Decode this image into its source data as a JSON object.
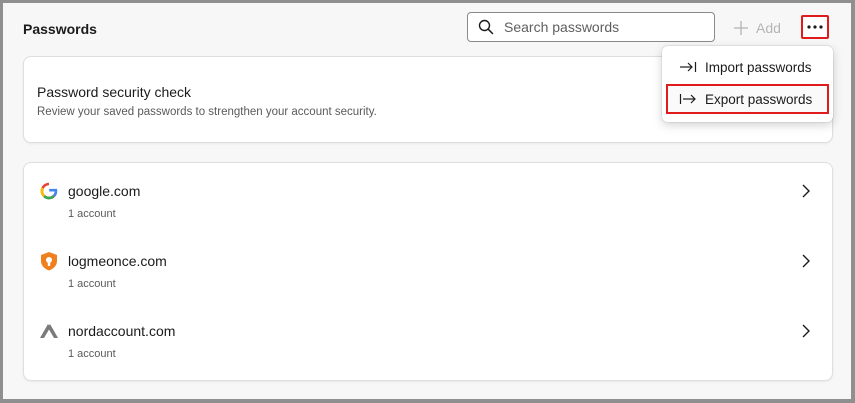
{
  "header": {
    "title": "Passwords",
    "search_placeholder": "Search passwords",
    "add_label": "Add"
  },
  "security_check": {
    "title": "Password security check",
    "subtitle": "Review your saved passwords to strengthen your account security."
  },
  "sites": [
    {
      "domain": "google.com",
      "count": "1 account",
      "icon": "google-icon"
    },
    {
      "domain": "logmeonce.com",
      "count": "1 account",
      "icon": "logmeonce-shield-icon"
    },
    {
      "domain": "nordaccount.com",
      "count": "1 account",
      "icon": "nordaccount-icon"
    }
  ],
  "menu": {
    "items": [
      {
        "label": "Import passwords",
        "icon": "import-icon"
      },
      {
        "label": "Export passwords",
        "icon": "export-icon"
      }
    ]
  },
  "colors": {
    "highlight": "#e01b1b",
    "logmeonce_orange": "#f07f1d",
    "nord_gray": "#7a7a7a"
  }
}
